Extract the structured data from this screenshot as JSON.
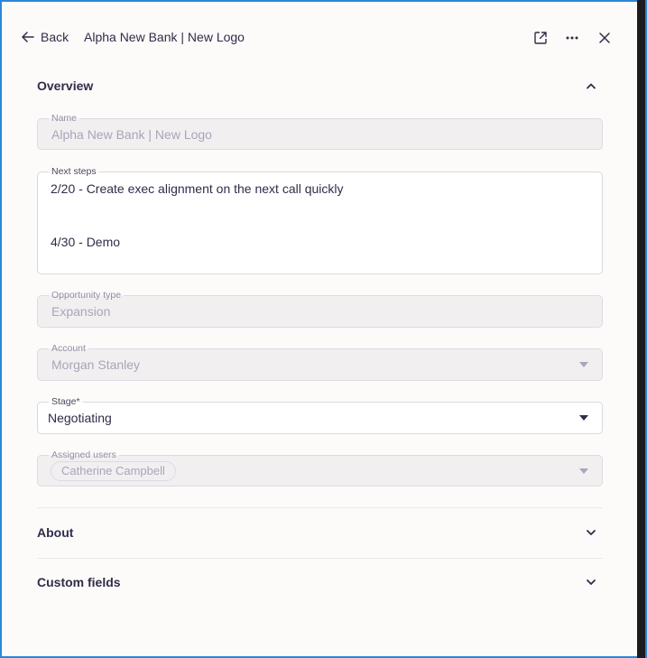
{
  "header": {
    "back_label": "Back",
    "title": "Alpha New Bank | New Logo",
    "icons": [
      "open-external-icon",
      "more-icon",
      "close-icon"
    ]
  },
  "overview": {
    "title": "Overview",
    "name": {
      "label": "Name",
      "value": "Alpha New Bank | New Logo"
    },
    "next_steps": {
      "label": "Next steps",
      "line1": "2/20 - Create exec alignment on the next call quickly",
      "line2": "4/30 - Demo"
    },
    "opportunity_type": {
      "label": "Opportunity type",
      "value": "Expansion"
    },
    "account": {
      "label": "Account",
      "value": "Morgan Stanley"
    },
    "stage": {
      "label": "Stage*",
      "value": "Negotiating"
    },
    "assigned_users": {
      "label": "Assigned users",
      "chip": "Catherine Campbell"
    }
  },
  "about": {
    "title": "About"
  },
  "custom_fields": {
    "title": "Custom fields"
  },
  "colors": {
    "frame": "#2b87d9",
    "text": "#2f2d48",
    "muted": "#a8a6b8",
    "background": "#fdfbf9"
  }
}
